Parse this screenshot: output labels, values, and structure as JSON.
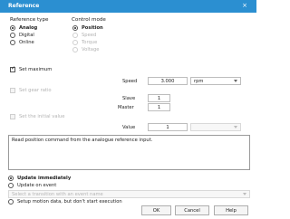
{
  "window": {
    "title": "Reference",
    "close_glyph": "×"
  },
  "reference_type": {
    "heading": "Reference type",
    "options": [
      {
        "label": "Analog",
        "selected": true
      },
      {
        "label": "Digital",
        "selected": false
      },
      {
        "label": "Online",
        "selected": false
      }
    ]
  },
  "control_mode": {
    "heading": "Control mode",
    "options": [
      {
        "label": "Position",
        "selected": true,
        "enabled": true
      },
      {
        "label": "Speed",
        "selected": false,
        "enabled": false
      },
      {
        "label": "Torque",
        "selected": false,
        "enabled": false
      },
      {
        "label": "Voltage",
        "selected": false,
        "enabled": false
      }
    ]
  },
  "set_maximum": {
    "label": "Set maximum",
    "checked": true
  },
  "speed": {
    "label": "Speed",
    "value": "3.000",
    "unit": "rpm"
  },
  "set_gear_ratio": {
    "label": "Set gear ratio",
    "checked": false,
    "enabled": false
  },
  "slave": {
    "label": "Slave",
    "value": "1"
  },
  "master": {
    "label": "Master",
    "value": "1"
  },
  "set_value": {
    "label": "Set the initial value",
    "checked": false,
    "enabled": false
  },
  "value": {
    "label": "Value",
    "value": "1",
    "unit": ""
  },
  "description": "Read position command from the analogue reference input.",
  "update": {
    "options": [
      {
        "label": "Update immediately",
        "selected": true
      },
      {
        "label": "Update on event",
        "selected": false
      }
    ],
    "event_dropdown": "Select a transition with an event name"
  },
  "setup_only": {
    "label": "Setup motion data, but don't start execution",
    "selected": false
  },
  "buttons": {
    "ok": "OK",
    "cancel": "Cancel",
    "help": "Help"
  },
  "colors": {
    "titlebar": "#2b8fd1",
    "disabled_text": "#b3b3b3"
  }
}
